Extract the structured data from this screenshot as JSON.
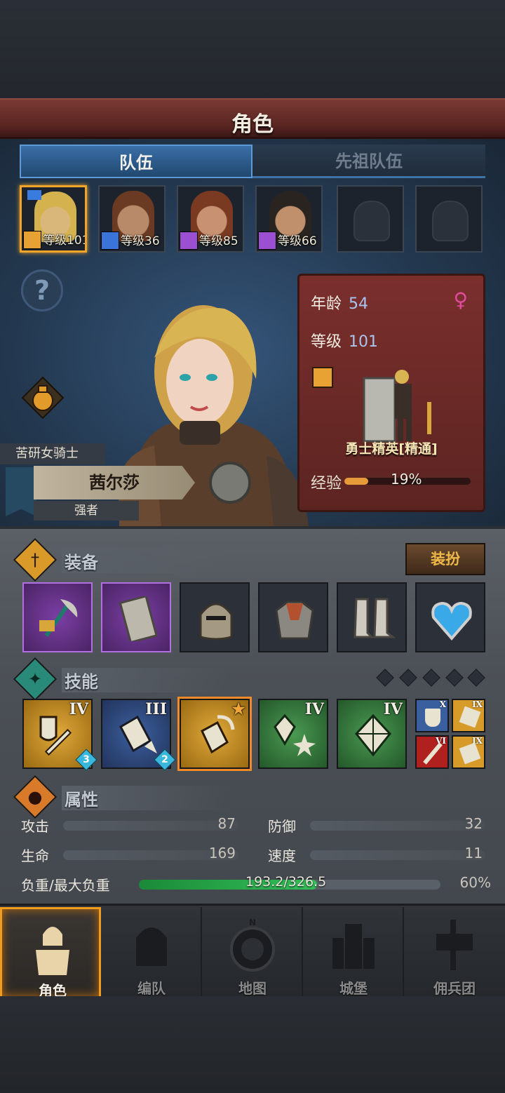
{
  "header": {
    "title": "角色"
  },
  "tabs": [
    {
      "label": "队伍",
      "active": true
    },
    {
      "label": "先祖队伍",
      "active": false
    }
  ],
  "roster": [
    {
      "level": "等级101",
      "class_color": "#e7a233",
      "face": "#d9b77a",
      "hair": "#d4b24d",
      "selected": true
    },
    {
      "level": "等级36",
      "class_color": "#3a74d8",
      "face": "#b98a6a",
      "hair": "#6b3a22",
      "selected": false
    },
    {
      "level": "等级85",
      "class_color": "#9b4fd1",
      "face": "#c89272",
      "hair": "#7a3a22",
      "selected": false
    },
    {
      "level": "等级66",
      "class_color": "#9b4fd1",
      "face": "#c0906c",
      "hair": "#2a2420",
      "selected": false
    }
  ],
  "character": {
    "title": "苦研女骑士",
    "name": "茜尔莎",
    "trait": "强者"
  },
  "info": {
    "age_label": "年龄",
    "age": "54",
    "level_label": "等级",
    "level": "101",
    "gender_icon": "♀",
    "job": "勇士精英[精通]",
    "exp_label": "经验",
    "exp_pct": "19%",
    "exp_value": 0.19
  },
  "equipment": {
    "label": "装备",
    "dress_button": "装扮",
    "slots": [
      {
        "icon": "warhammer-icon",
        "rarity": "purple"
      },
      {
        "icon": "tower-shield-icon",
        "rarity": "purple"
      },
      {
        "icon": "helmet-icon",
        "rarity": "normal"
      },
      {
        "icon": "armor-icon",
        "rarity": "normal"
      },
      {
        "icon": "boots-icon",
        "rarity": "normal"
      },
      {
        "icon": "heart-amulet-icon",
        "rarity": "normal"
      }
    ]
  },
  "skills": {
    "label": "技能",
    "items": [
      {
        "icon": "shield-sword-skill-icon",
        "rank": "IV",
        "count": "3",
        "color": "gold"
      },
      {
        "icon": "shield-bash-skill-icon",
        "rank": "III",
        "count": "2",
        "color": "blue"
      },
      {
        "icon": "shield-charge-skill-icon",
        "rank": "★",
        "count": "",
        "color": "gold"
      },
      {
        "icon": "crystal-burst-skill-icon",
        "rank": "IV",
        "count": "",
        "color": "green"
      },
      {
        "icon": "crystal-skill-icon",
        "rank": "IV",
        "count": "",
        "color": "green"
      }
    ],
    "mini": [
      {
        "icon": "shield-plus-skill-icon",
        "rank": "X",
        "color": "#3a5f9e"
      },
      {
        "icon": "shield-strike-skill-icon",
        "rank": "IX",
        "color": "#d79b2a"
      },
      {
        "icon": "sword-skill-icon",
        "rank": "VI",
        "color": "#b0201e"
      },
      {
        "icon": "shield-break-skill-icon",
        "rank": "IX",
        "color": "#d79b2a"
      }
    ]
  },
  "attributes": {
    "label": "属性",
    "attack_label": "攻击",
    "attack": "87",
    "defense_label": "防御",
    "defense": "32",
    "hp_label": "生命",
    "hp": "169",
    "speed_label": "速度",
    "speed": "11",
    "load_label": "负重/最大负重",
    "load": "193.2/326.5",
    "load_pct": "60%",
    "load_value": 0.59
  },
  "nav": [
    {
      "label": "角色",
      "active": true
    },
    {
      "label": "编队",
      "active": false
    },
    {
      "label": "地图",
      "active": false,
      "compass": "N"
    },
    {
      "label": "城堡",
      "active": false
    },
    {
      "label": "佣兵团",
      "active": false
    }
  ]
}
